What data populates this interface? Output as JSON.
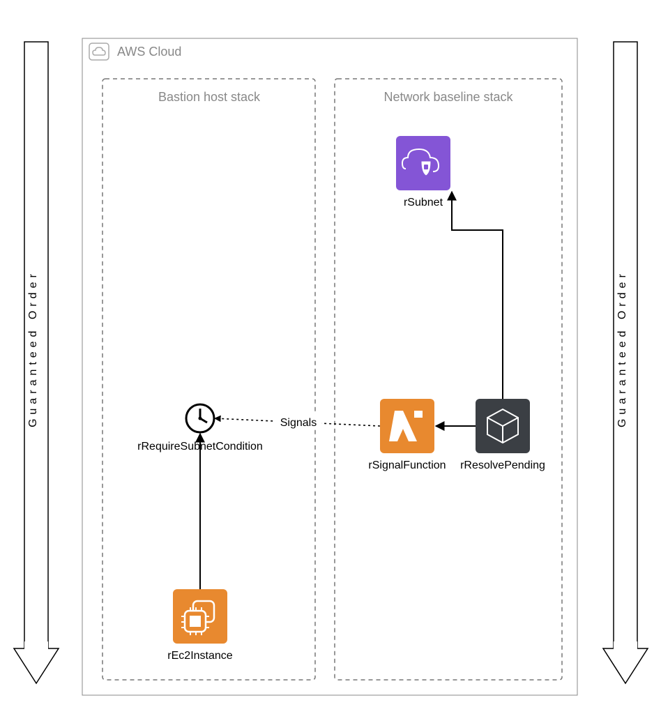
{
  "diagram": {
    "cloud_label": "AWS Cloud",
    "left_arrow_label": "Guaranteed Order",
    "right_arrow_label": "Guaranteed Order",
    "stack_left": "Bastion host stack",
    "stack_right": "Network baseline stack",
    "nodes": {
      "rSubnet": "rSubnet",
      "rSignalFunction": "rSignalFunction",
      "rResolvePending": "rResolvePending",
      "rRequireSubnetCondition": "rRequireSubnetCondition",
      "rEc2Instance": "rEc2Instance"
    },
    "edges": {
      "signals": "Signals"
    }
  }
}
